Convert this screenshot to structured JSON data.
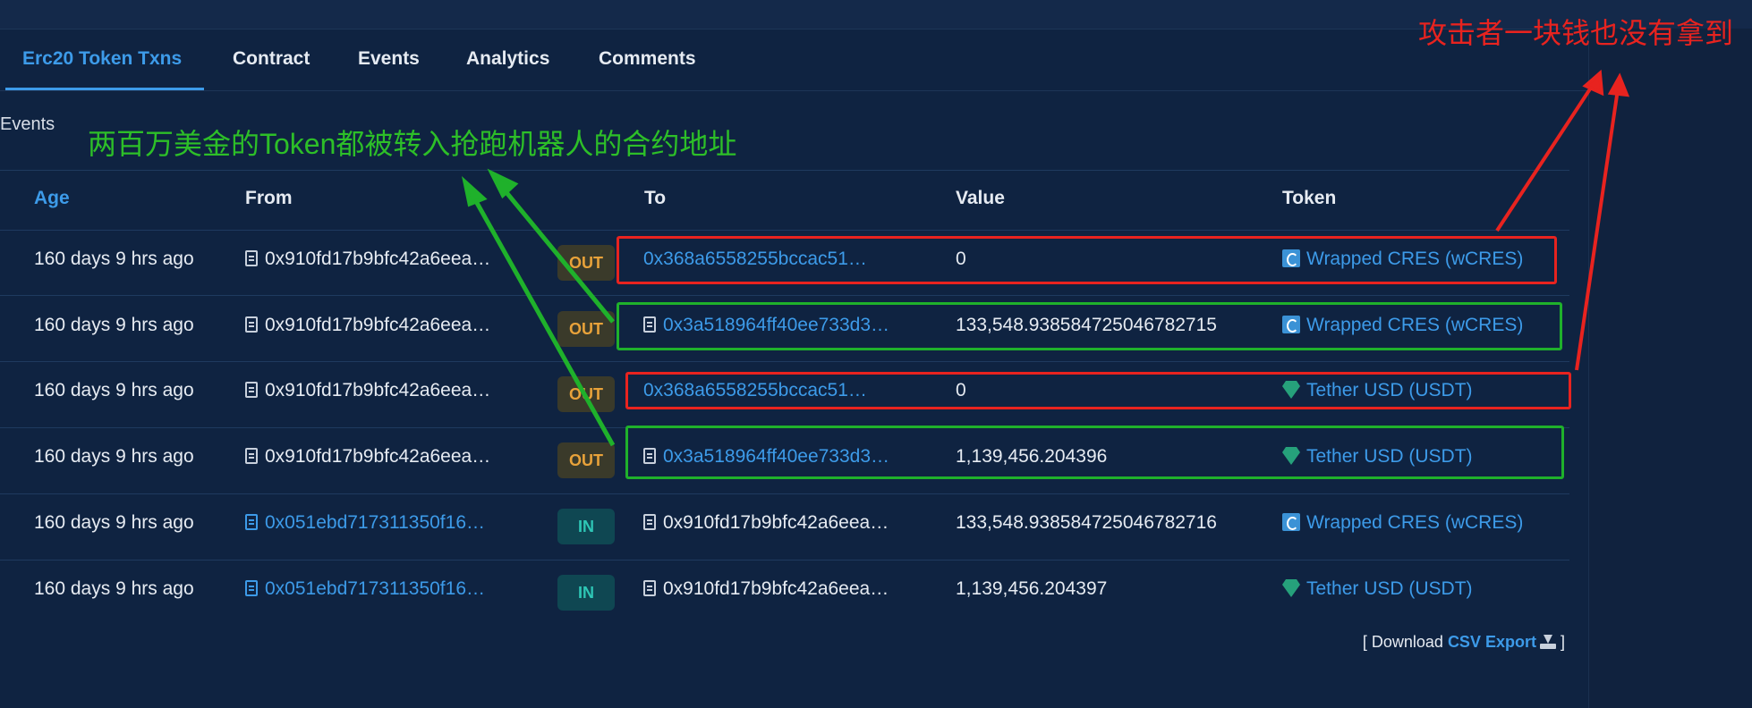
{
  "tabs": [
    "Erc20 Token Txns",
    "Contract",
    "Events",
    "Analytics",
    "Comments"
  ],
  "events_label": "Events",
  "columns": {
    "age": "Age",
    "from": "From",
    "to": "To",
    "value": "Value",
    "token": "Token"
  },
  "rows": [
    {
      "age": "160 days 9 hrs ago",
      "from": "0x910fd17b9bfc42a6eea…",
      "direction": "OUT",
      "to": "0x368a6558255bccac51…",
      "value": "0",
      "token": "Wrapped CRES (wCRES)"
    },
    {
      "age": "160 days 9 hrs ago",
      "from": "0x910fd17b9bfc42a6eea…",
      "direction": "OUT",
      "to": "0x3a518964ff40ee733d3…",
      "value": "133,548.938584725046782715",
      "token": "Wrapped CRES (wCRES)"
    },
    {
      "age": "160 days 9 hrs ago",
      "from": "0x910fd17b9bfc42a6eea…",
      "direction": "OUT",
      "to": "0x368a6558255bccac51…",
      "value": "0",
      "token": "Tether USD (USDT)"
    },
    {
      "age": "160 days 9 hrs ago",
      "from": "0x910fd17b9bfc42a6eea…",
      "direction": "OUT",
      "to": "0x3a518964ff40ee733d3…",
      "value": "1,139,456.204396",
      "token": "Tether USD (USDT)"
    },
    {
      "age": "160 days 9 hrs ago",
      "from": "0x051ebd717311350f16…",
      "direction": "IN",
      "to": "0x910fd17b9bfc42a6eea…",
      "value": "133,548.938584725046782716",
      "token": "Wrapped CRES (wCRES)"
    },
    {
      "age": "160 days 9 hrs ago",
      "from": "0x051ebd717311350f16…",
      "direction": "IN",
      "to": "0x910fd17b9bfc42a6eea…",
      "value": "1,139,456.204397",
      "token": "Tether USD (USDT)"
    }
  ],
  "download": {
    "prefix": "[ Download",
    "link": "CSV Export",
    "suffix": "]"
  },
  "annotations": {
    "green": "两百万美金的Token都被转入抢跑机器人的合约地址",
    "red": "攻击者一块钱也没有拿到"
  },
  "colors": {
    "link": "#3d9be9",
    "annotation_red": "#e8231f",
    "annotation_green": "#1fb12b"
  },
  "icons": {
    "file": "file-contract-icon",
    "wcres": "wcres-token-icon",
    "usdt": "usdt-token-icon",
    "download": "download-icon"
  }
}
